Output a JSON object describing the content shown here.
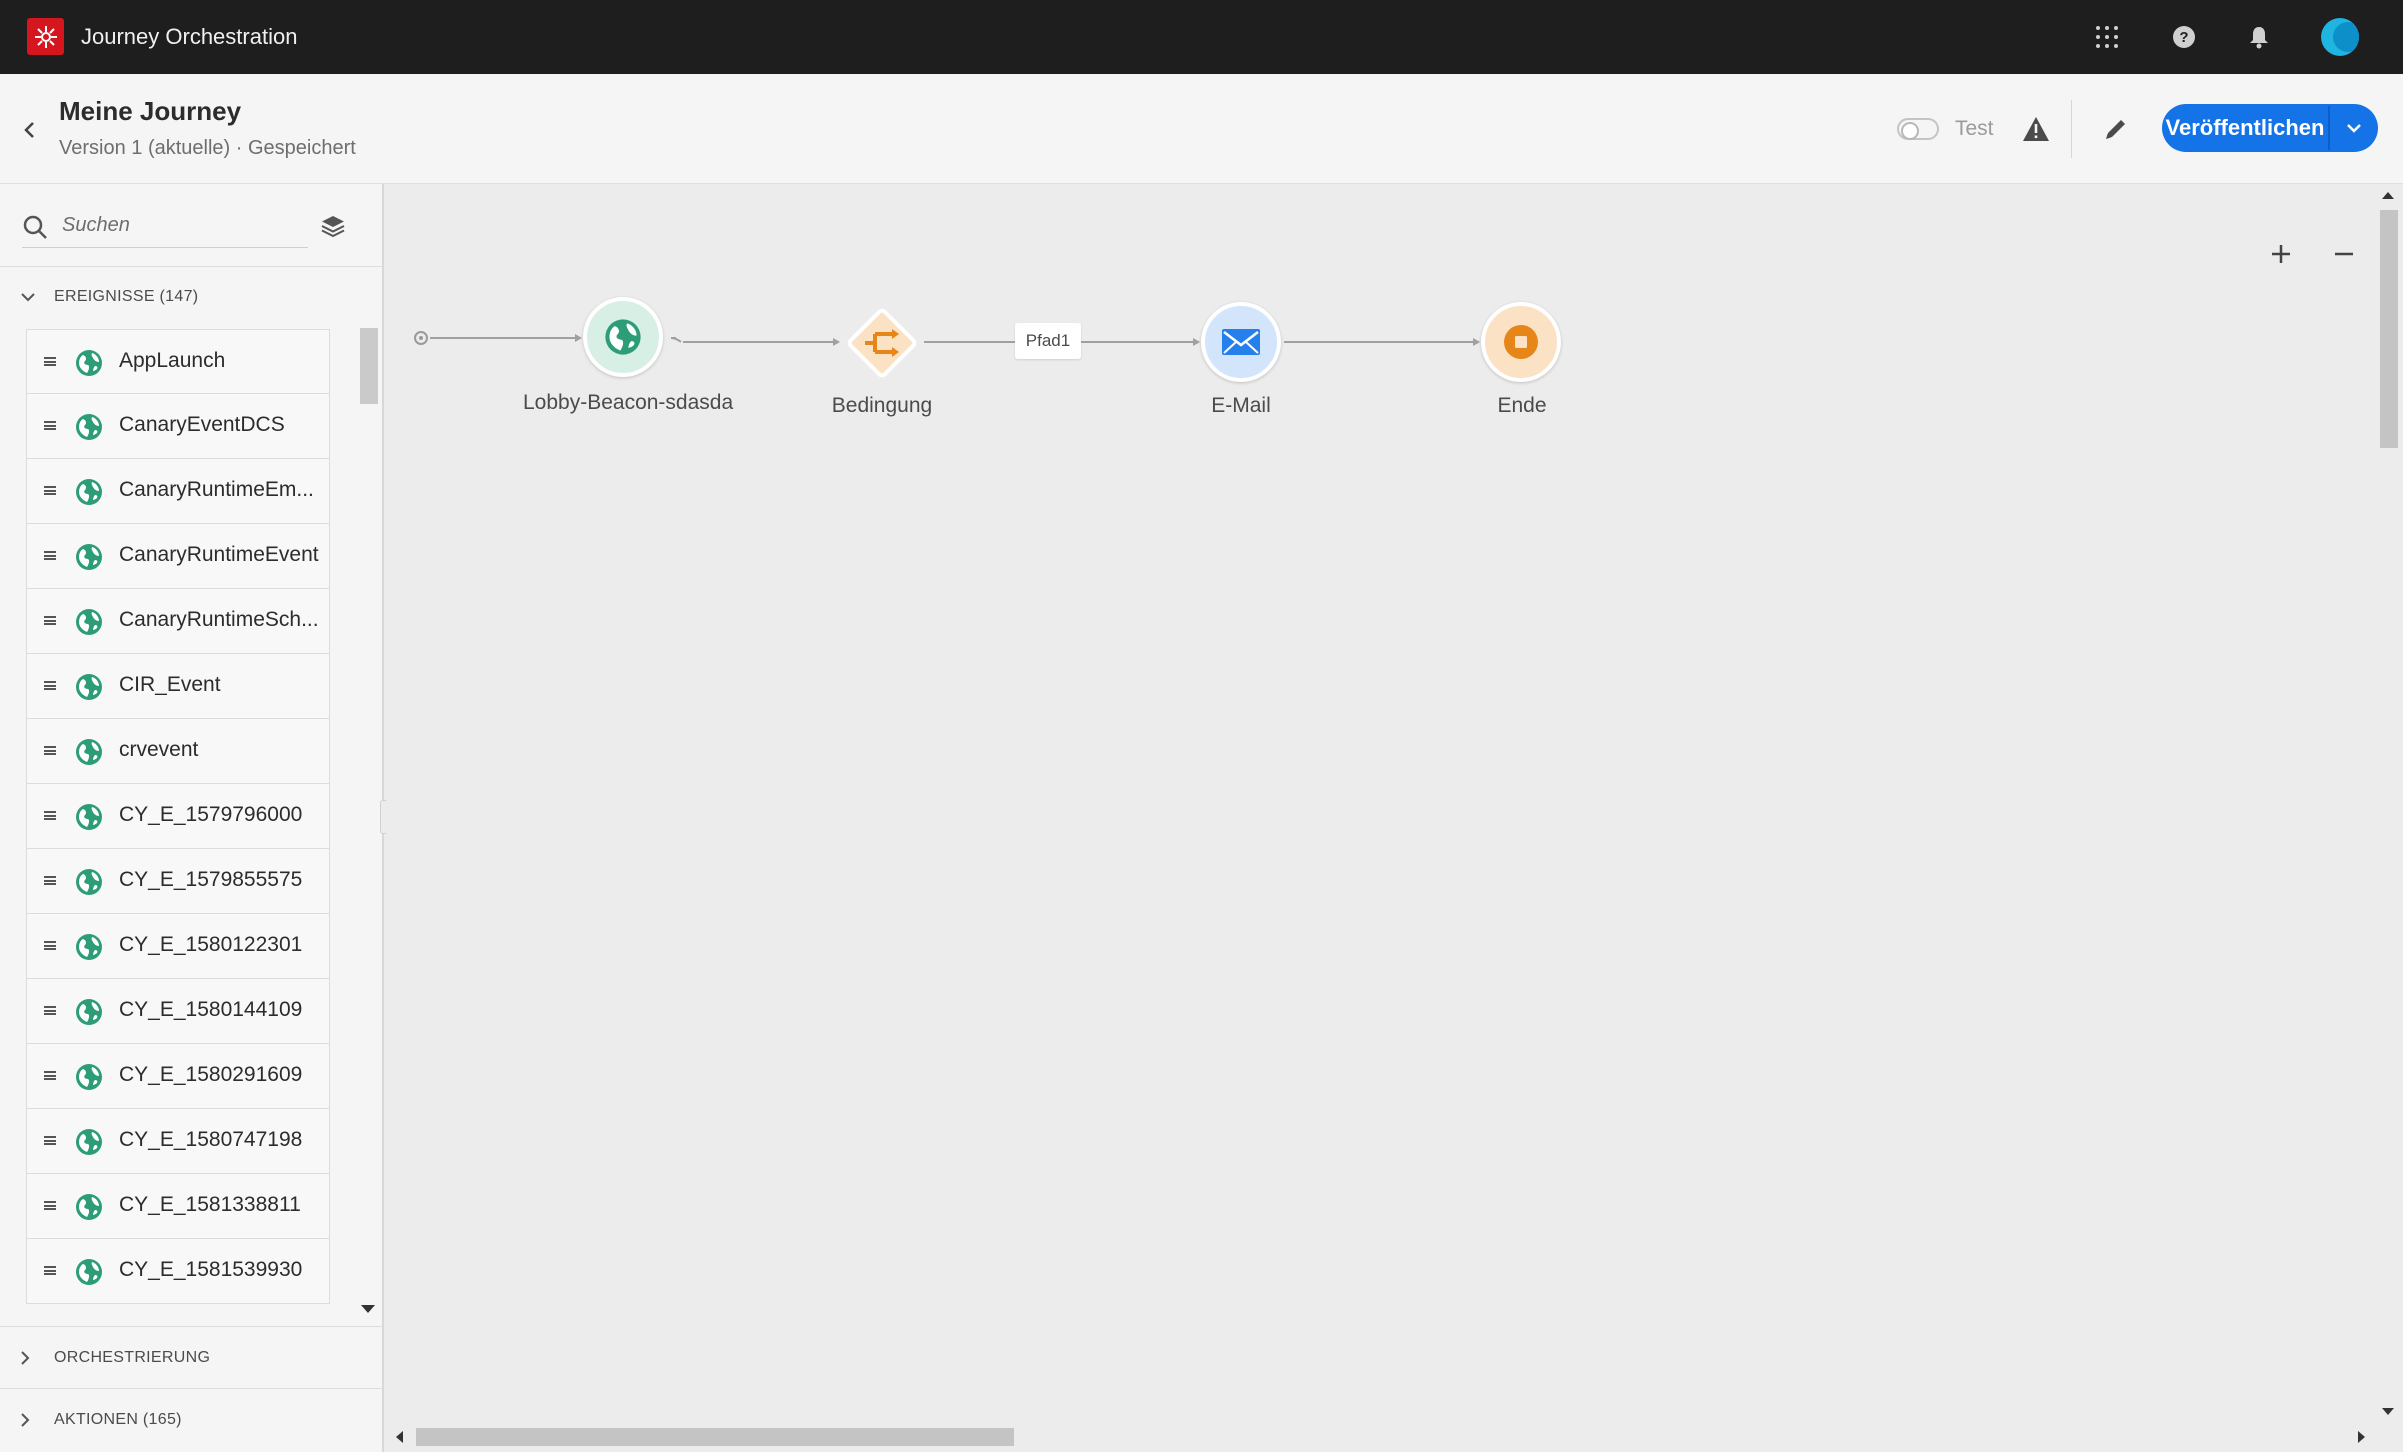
{
  "app": {
    "title": "Journey Orchestration",
    "icons": [
      "apps-grid-icon",
      "help-icon",
      "bell-icon",
      "avatar"
    ]
  },
  "header": {
    "title": "Meine Journey",
    "subtitle": "Version 1 (aktuelle) · Gespeichert",
    "test_label": "Test",
    "test_enabled": false,
    "publish_label": "Veröffentlichen",
    "accent_color": "#1473e6"
  },
  "sidebar": {
    "search_placeholder": "Suchen",
    "events_section": "EREIGNISSE (147)",
    "events": [
      "AppLaunch",
      "CanaryEventDCS",
      "CanaryRuntimeEm...",
      "CanaryRuntimeEvent",
      "CanaryRuntimeSch...",
      "CIR_Event",
      "crvevent",
      "CY_E_1579796000",
      "CY_E_1579855575",
      "CY_E_1580122301",
      "CY_E_1580144109",
      "CY_E_1580291609",
      "CY_E_1580747198",
      "CY_E_1581338811",
      "CY_E_1581539930"
    ],
    "orchestration_section": "ORCHESTRIERUNG",
    "actions_section": "AKTIONEN (165)"
  },
  "canvas": {
    "nodes": {
      "event": "Lobby-Beacon-sdasda",
      "condition": "Bedingung",
      "email": "E-Mail",
      "end": "Ende"
    },
    "path_label": "Pfad1",
    "colors": {
      "event": "#2d9d78",
      "condition": "#e68619",
      "email": "#2680eb",
      "end": "#e68619"
    }
  }
}
